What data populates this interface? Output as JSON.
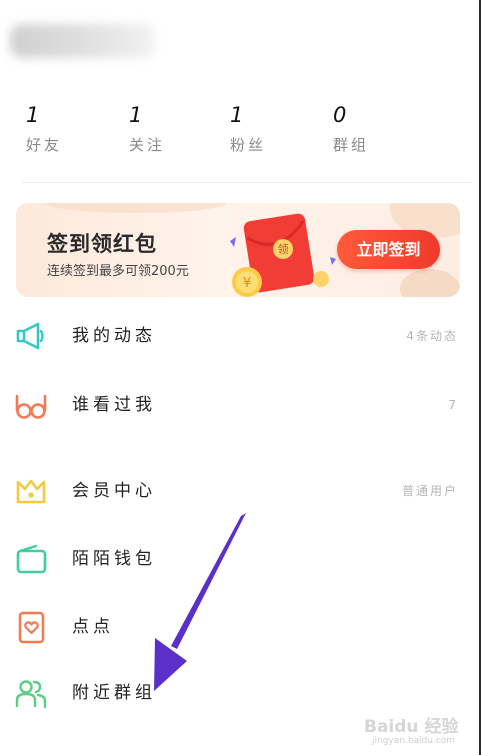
{
  "stats": [
    {
      "value": "1",
      "label": "好友"
    },
    {
      "value": "1",
      "label": "关注"
    },
    {
      "value": "1",
      "label": "粉丝"
    },
    {
      "value": "0",
      "label": "群组"
    }
  ],
  "banner": {
    "title": "签到领红包",
    "subtitle": "连续签到最多可领200元",
    "button_label": "立即签到",
    "envelope_text": "领",
    "coin_symbol": "¥"
  },
  "menu": [
    {
      "label": "我的动态",
      "right": "4条动态",
      "icon": "megaphone-icon",
      "color": "#33c7c7"
    },
    {
      "label": "谁看过我",
      "right": "7",
      "icon": "glasses-icon",
      "color": "#f47a55"
    },
    {
      "label": "会员中心",
      "right": "普通用户",
      "icon": "crown-icon",
      "color": "#f7c840"
    },
    {
      "label": "陌陌钱包",
      "right": "",
      "icon": "wallet-icon",
      "color": "#3fcf9a"
    },
    {
      "label": "点点",
      "right": "",
      "icon": "heart-card-icon",
      "color": "#f47a55"
    },
    {
      "label": "附近群组",
      "right": "",
      "icon": "group-icon",
      "color": "#5ccd84"
    }
  ],
  "watermark": {
    "text": "Baidu 经验",
    "url": "jingyan.baidu.com"
  },
  "colors": {
    "accent_red": "#f03a2c",
    "arrow": "#5b2fc9"
  }
}
